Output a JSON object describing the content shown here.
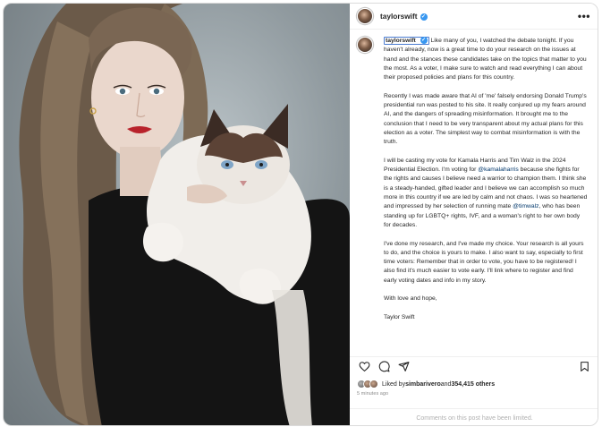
{
  "post": {
    "username": "taylorswift",
    "verified_badge": "✓"
  },
  "caption": {
    "username": "taylorswift",
    "p1": "Like many of you, I watched the debate tonight. If you haven't already, now is a great time to do your research on the issues at hand and the stances these candidates take on the topics that matter to you the most. As a voter, I make sure to watch and read everything I can about their proposed policies and plans for this country.",
    "p2": "Recently I was made aware that AI of 'me' falsely endorsing Donald Trump's presidential run was posted to his site. It really conjured up my fears around AI, and the dangers of spreading misinformation. It brought me to the conclusion that I need to be very transparent about my actual plans for this election as a voter. The simplest way to combat misinformation is with the truth.",
    "p3_before": "I will be casting my vote for Kamala Harris and Tim Walz in the 2024 Presidential Election. I'm voting for ",
    "p3_mention1": "@kamalaharris",
    "p3_middle": " because she fights for the rights and causes I believe need a warrior to champion them. I think she is a steady-handed, gifted leader and I believe we can accomplish so much more in this country if we are led by calm and not chaos. I was so heartened and impressed by her selection of running mate ",
    "p3_mention2": "@timwalz",
    "p3_after": ", who has been standing up for LGBTQ+ rights, IVF, and a woman's right to her own body for decades.",
    "p4": "I've done my research, and I've made my choice. Your research is all yours to do, and the choice is yours to make. I also want to say, especially to first time voters: Remember that in order to vote, you have to be registered! I also find it's much easier to vote early. I'll link where to register and find early voting dates and info in my story.",
    "p5": "With love and hope,",
    "p6": "Taylor Swift"
  },
  "likes": {
    "prefix": "Liked by ",
    "user": "simbarivero",
    "middle": " and ",
    "count": "354,415 others"
  },
  "timestamp": "5 minutes ago",
  "comments_notice": "Comments on this post have been limited.",
  "icons": {
    "more": "more-options-icon",
    "like": "heart-icon",
    "comment": "comment-icon",
    "share": "share-icon",
    "save": "bookmark-icon"
  },
  "colors": {
    "accent": "#3897f0",
    "mention": "#00376b",
    "muted": "#8e8e8e"
  }
}
